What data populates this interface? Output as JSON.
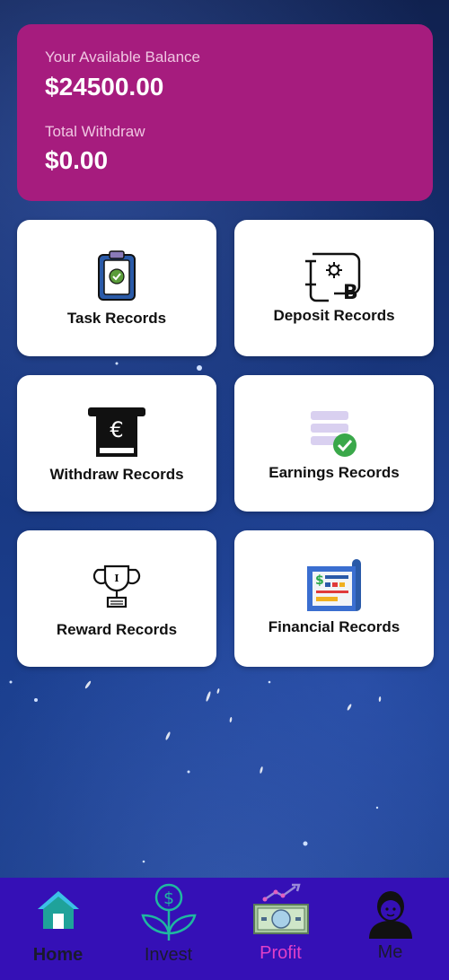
{
  "balance": {
    "available_label": "Your Available Balance",
    "available_value": "$24500.00",
    "withdraw_label": "Total Withdraw",
    "withdraw_value": "$0.00"
  },
  "records": [
    {
      "label": "Task Records",
      "icon": "clipboard-check-icon"
    },
    {
      "label": "Deposit Records",
      "icon": "bitcoin-deposit-icon"
    },
    {
      "label": "Withdraw Records",
      "icon": "euro-atm-icon"
    },
    {
      "label": "Earnings Records",
      "icon": "database-check-icon"
    },
    {
      "label": "Reward Records",
      "icon": "trophy-icon"
    },
    {
      "label": "Financial Records",
      "icon": "financial-report-icon"
    }
  ],
  "nav": {
    "items": [
      {
        "label": "Home",
        "icon": "house-icon"
      },
      {
        "label": "Invest",
        "icon": "money-plant-icon"
      },
      {
        "label": "Profit",
        "icon": "banknote-chart-icon"
      },
      {
        "label": "Me",
        "icon": "user-avatar-icon"
      }
    ],
    "active": "Home",
    "colors": {
      "home": "#1a1a2e",
      "invest": "#1a1a2e",
      "profit": "#e040c8",
      "me": "#1a1a2e"
    }
  },
  "colors": {
    "balance_card": "#a61c7e",
    "bottom_bar": "#3510b6"
  }
}
